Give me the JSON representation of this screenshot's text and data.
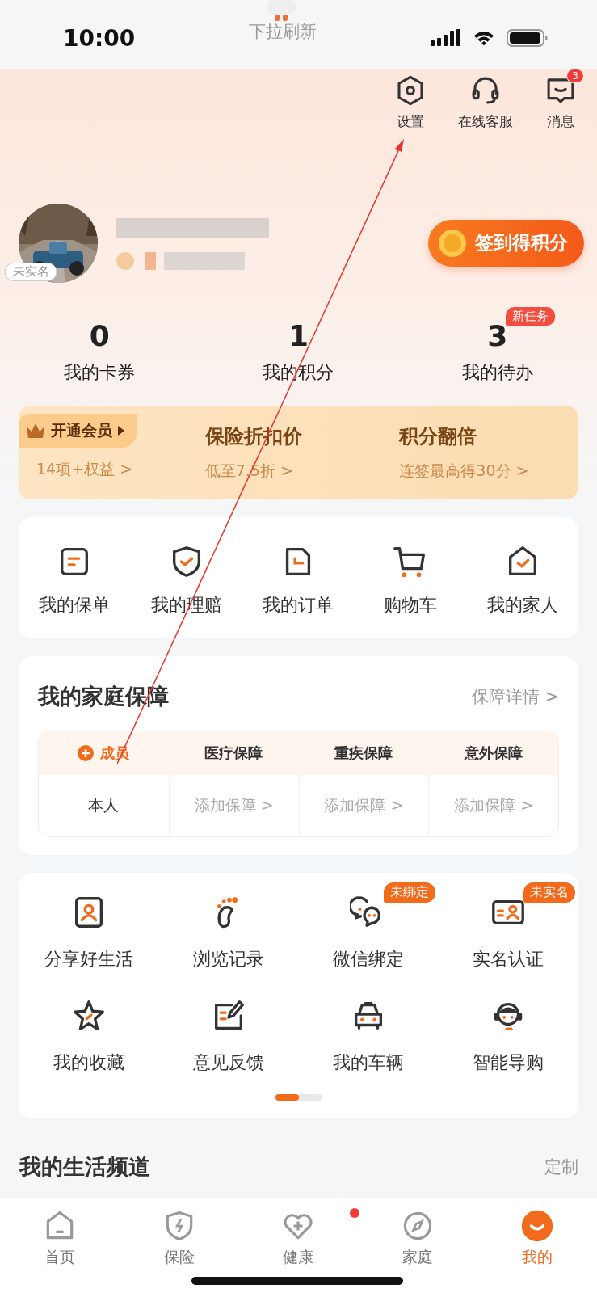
{
  "pull_hint": "下拉刷新",
  "status_bar": {
    "time": "10:00"
  },
  "header_actions": [
    {
      "label": "设置"
    },
    {
      "label": "在线客服"
    },
    {
      "label": "消息",
      "badge": "3"
    }
  ],
  "profile": {
    "avatar_tag": "未实名",
    "checkin_button": "签到得积分"
  },
  "stats": [
    {
      "value": "0",
      "label": "我的卡券"
    },
    {
      "value": "1",
      "label": "我的积分"
    },
    {
      "value": "3",
      "label": "我的待办",
      "badge": "新任务"
    }
  ],
  "member_banner": [
    {
      "title": "开通会员",
      "subtitle": "14项+权益 >",
      "kind": "vip"
    },
    {
      "title": "保险折扣价",
      "subtitle": "低至7.5折 >",
      "kind": "plain"
    },
    {
      "title": "积分翻倍",
      "subtitle": "连签最高得30分 >",
      "kind": "plain"
    }
  ],
  "quick_links": [
    {
      "label": "我的保单"
    },
    {
      "label": "我的理赔"
    },
    {
      "label": "我的订单"
    },
    {
      "label": "购物车"
    },
    {
      "label": "我的家人"
    }
  ],
  "family_protection": {
    "title": "我的家庭保障",
    "link": "保障详情 >",
    "columns": [
      "成员",
      "医疗保障",
      "重疾保障",
      "意外保障"
    ],
    "rows": [
      {
        "cells": [
          "本人",
          "添加保障 >",
          "添加保障 >",
          "添加保障 >"
        ]
      }
    ]
  },
  "services": [
    {
      "label": "分享好生活"
    },
    {
      "label": "浏览记录"
    },
    {
      "label": "微信绑定",
      "badge": "未绑定"
    },
    {
      "label": "实名认证",
      "badge": "未实名"
    },
    {
      "label": "我的收藏"
    },
    {
      "label": "意见反馈"
    },
    {
      "label": "我的车辆"
    },
    {
      "label": "智能导购"
    }
  ],
  "life_channel": {
    "title": "我的生活频道",
    "action": "定制"
  },
  "tab_bar": [
    {
      "label": "首页",
      "selected": false,
      "dot": false
    },
    {
      "label": "保险",
      "selected": false,
      "dot": false
    },
    {
      "label": "健康",
      "selected": false,
      "dot": true
    },
    {
      "label": "家庭",
      "selected": false,
      "dot": false
    },
    {
      "label": "我的",
      "selected": true,
      "dot": false
    }
  ]
}
